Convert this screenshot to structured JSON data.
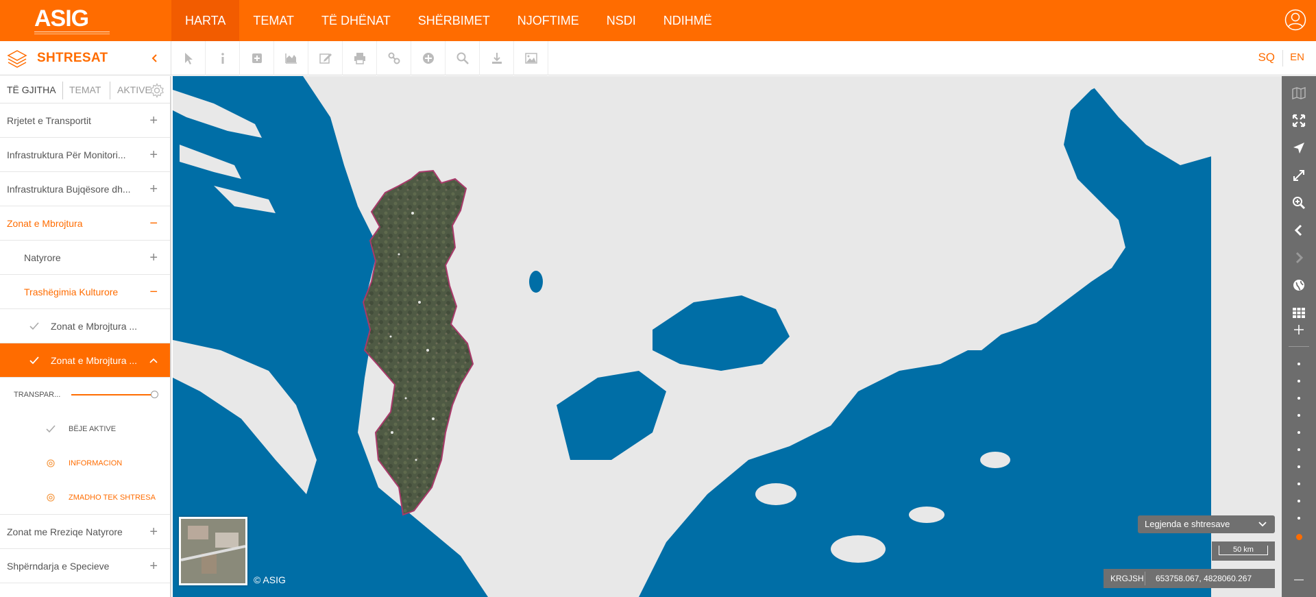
{
  "header": {
    "logo_text": "ASIG",
    "nav": [
      "HARTA",
      "TEMAT",
      "TË DHËNAT",
      "SHËRBIMET",
      "NJOFTIME",
      "NSDI",
      "NDIHMË"
    ],
    "active_nav": "HARTA"
  },
  "layers_panel": {
    "title": "SHTRESAT",
    "tabs": [
      "TË GJITHA",
      "TEMAT",
      "AKTIVE"
    ],
    "items": {
      "i0": {
        "label": "Rrjetet e Transportit",
        "sign": "+"
      },
      "i1": {
        "label": "Infrastruktura Për Monitori...",
        "sign": "+"
      },
      "i2": {
        "label": "Infrastruktura Bujqësore dh...",
        "sign": "+"
      },
      "i3": {
        "label": "Zonat e Mbrojtura",
        "sign": "−"
      },
      "i4": {
        "label": "Natyrore",
        "sign": "+"
      },
      "i5": {
        "label": "Trashëgimia Kulturore",
        "sign": "−"
      },
      "i6": {
        "label": "Zonat e Mbrojtura ..."
      },
      "i7": {
        "label": "Zonat e Mbrojtura ..."
      },
      "i8": {
        "label": "Zonat me Rreziqe Natyrore",
        "sign": "+"
      },
      "i9": {
        "label": "Shpërndarja e Specieve",
        "sign": "+"
      }
    },
    "selected_layer": {
      "transparency_label": "TRANSPAR...",
      "transparency": 1.0,
      "make_active": "BËJE AKTIVE",
      "info": "INFORMACION",
      "zoom_to": "ZMADHO TEK SHTRESA"
    }
  },
  "toolbar": {
    "tools": [
      "select-icon",
      "info-icon",
      "add-icon",
      "profile-chart-icon",
      "edit-icon",
      "print-icon",
      "link-icon",
      "plus-circle-icon",
      "search-icon",
      "download-icon",
      "image-icon"
    ]
  },
  "language": {
    "sq": "SQ",
    "en": "EN"
  },
  "map": {
    "legend_button": "Legjenda e shtresave",
    "scale_label": "50 km",
    "crs": "KRGJSH",
    "coordinates": "653758.067, 4828060.267",
    "copyright": "© ASIG"
  },
  "colors": {
    "accent": "#ff6c00",
    "water": "#006ea6",
    "land": "#e8e8e8",
    "rail": "#6d6d6d"
  }
}
